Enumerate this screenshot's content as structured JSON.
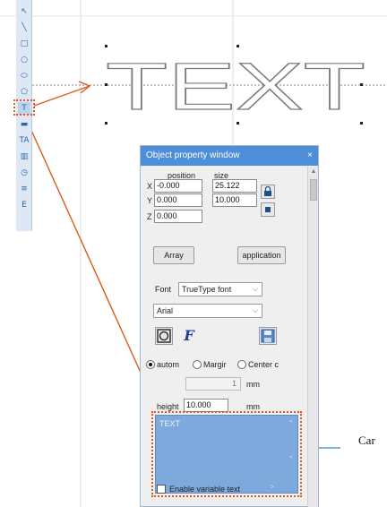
{
  "canvas": {
    "sample_text": "TEXT"
  },
  "toolbar": {
    "tools": [
      {
        "name": "select-tool-icon",
        "glyph": "↖"
      },
      {
        "name": "line-tool-icon",
        "glyph": "╲"
      },
      {
        "name": "rectangle-tool-icon",
        "glyph": "□"
      },
      {
        "name": "circle-tool-icon",
        "glyph": "○"
      },
      {
        "name": "ellipse-tool-icon",
        "glyph": "⬭"
      },
      {
        "name": "polygon-tool-icon",
        "glyph": "⬠"
      },
      {
        "name": "text-tool-icon",
        "glyph": "T"
      },
      {
        "name": "bitmap-tool-icon",
        "glyph": "▬"
      },
      {
        "name": "text-path-tool-icon",
        "glyph": "TA"
      },
      {
        "name": "barcode-tool-icon",
        "glyph": "▥"
      },
      {
        "name": "timer-tool-icon",
        "glyph": "◷"
      },
      {
        "name": "input-tool-icon",
        "glyph": "≡"
      },
      {
        "name": "extend-tool-icon",
        "glyph": "E"
      }
    ],
    "active_index": 6
  },
  "prop_window": {
    "title": "Object property window",
    "close": "×",
    "position_label": "position",
    "size_label": "size",
    "x_label": "X",
    "y_label": "Y",
    "z_label": "Z",
    "x_value": "-0.000",
    "y_value": "0.000",
    "z_value": "0.000",
    "width_value": "25.122",
    "height_value": "10.000",
    "array_button": "Array",
    "application_button": "application",
    "font_label": "Font",
    "font_type_value": "TrueType font",
    "font_name_value": "Arial",
    "align_options": [
      "autom",
      "Margir",
      "Center c"
    ],
    "align_selected": 0,
    "spacing_value": "1",
    "spacing_unit": "mm",
    "height_label": "height",
    "height_unit": "mm",
    "text_content": "TEXT",
    "variable_text_label": "Enable variable text"
  },
  "callout": {
    "label": "Car"
  },
  "colors": {
    "accent": "#4e8ed8",
    "callout_line": "#e05a1d",
    "leader_line": "#2b8ad6"
  }
}
